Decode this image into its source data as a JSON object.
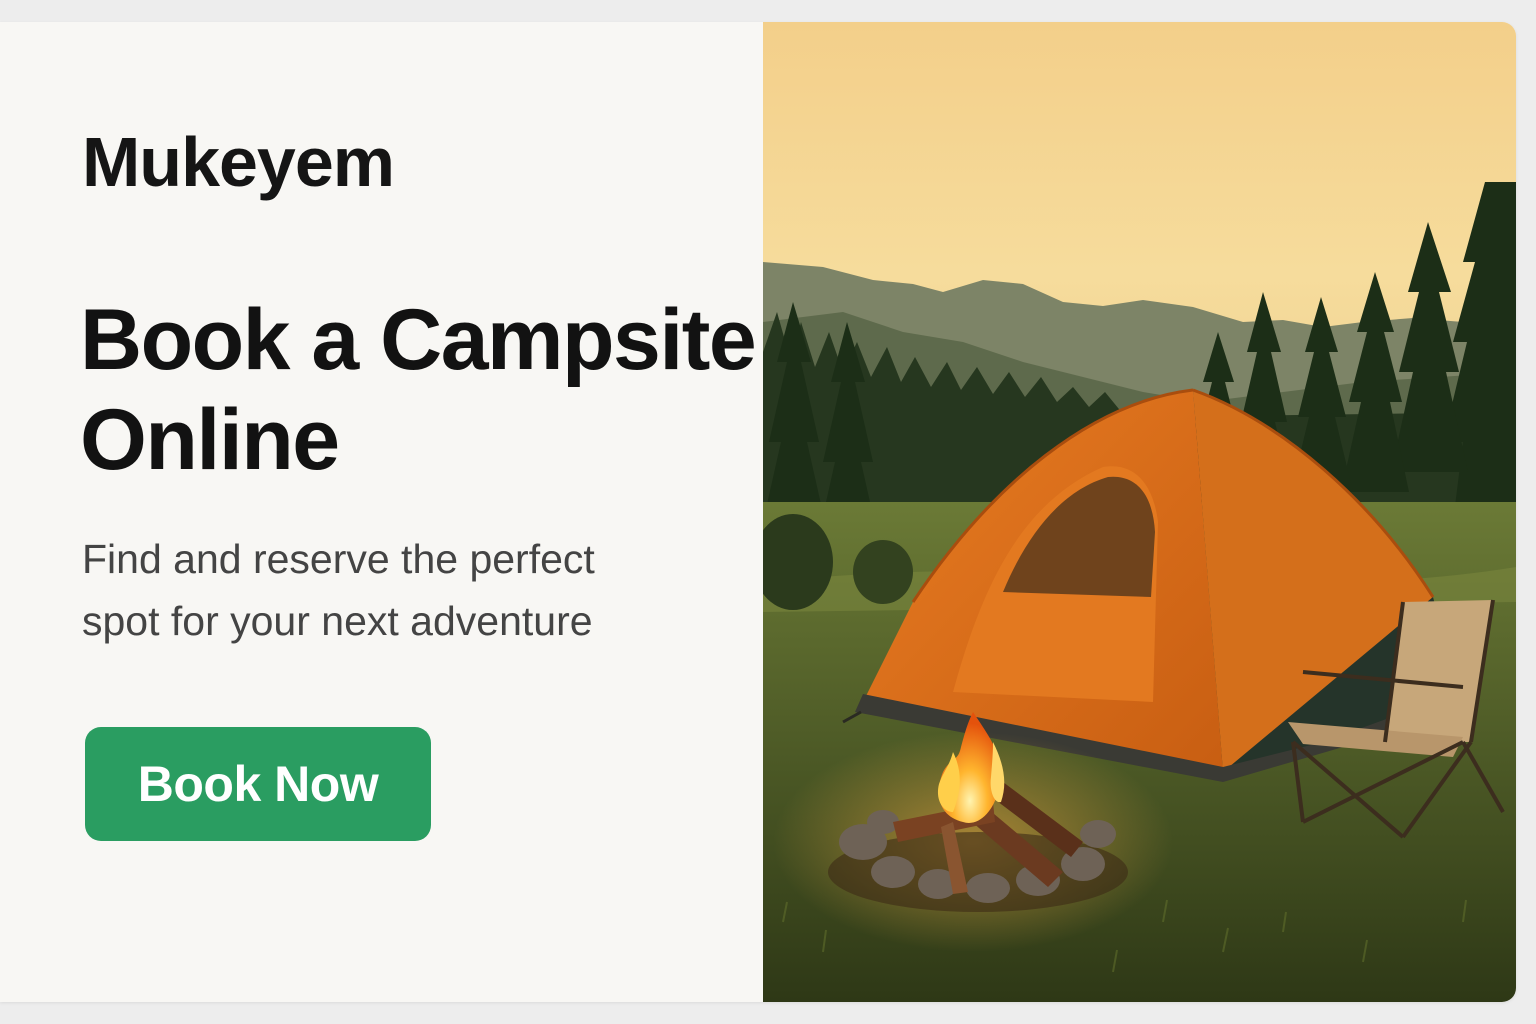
{
  "brand": {
    "name": "Mukeyem"
  },
  "hero": {
    "headline_line1": "Book a Campsite",
    "headline_line2": "Online",
    "subtitle_line1": "Find and reserve the perfect",
    "subtitle_line2": "spot for your next adventure",
    "cta_label": "Book Now"
  },
  "image": {
    "subject": "orange-tent-campfire-chair-at-sunset"
  },
  "colors": {
    "accent": "#2a9d61",
    "background": "#f8f7f4",
    "text": "#121212",
    "muted_text": "#444444"
  }
}
